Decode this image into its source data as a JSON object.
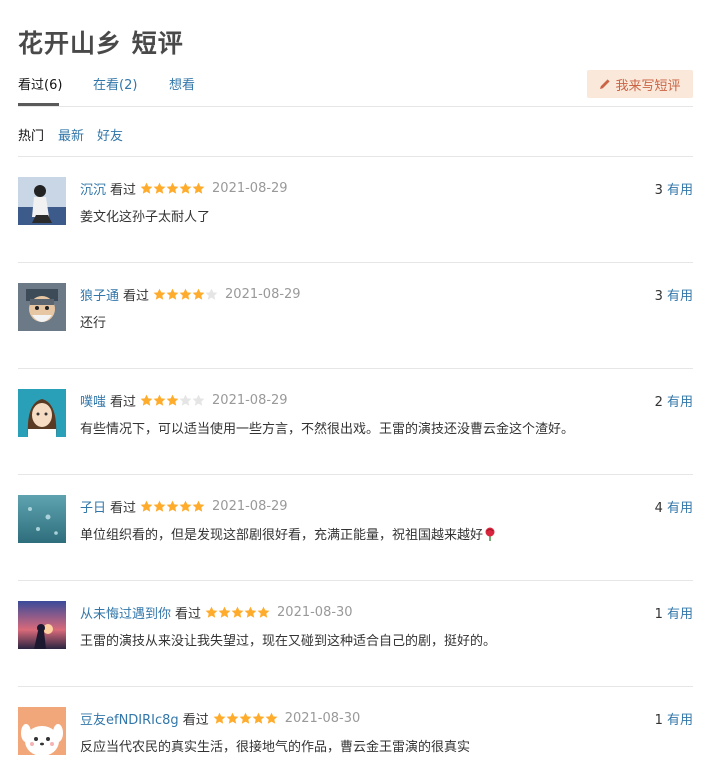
{
  "page_title": "花开山乡 短评",
  "tabs": [
    {
      "label": "看过(6)"
    },
    {
      "label": "在看(2)"
    },
    {
      "label": "想看"
    }
  ],
  "write_button": {
    "label": "我来写短评",
    "icon": "pencil-icon"
  },
  "filters": [
    {
      "label": "热门"
    },
    {
      "label": "最新"
    },
    {
      "label": "好友"
    }
  ],
  "colors": {
    "link": "#3377aa",
    "star": "#ffac2d",
    "star_empty": "#e5e5e5",
    "button_bg": "#fae9da",
    "button_text": "#ca6445"
  },
  "comments": [
    {
      "user": "沉沉",
      "status": "看过",
      "rating": 5,
      "date": "2021-08-29",
      "votes": "3",
      "votes_label": "有用",
      "content": "姜文化这孙子太耐人了"
    },
    {
      "user": "狼子通",
      "status": "看过",
      "rating": 4,
      "date": "2021-08-29",
      "votes": "3",
      "votes_label": "有用",
      "content": "还行"
    },
    {
      "user": "噗嗤",
      "status": "看过",
      "rating": 3,
      "date": "2021-08-29",
      "votes": "2",
      "votes_label": "有用",
      "content": "有些情况下，可以适当使用一些方言，不然很出戏。王雷的演技还没曹云金这个渣好。"
    },
    {
      "user": "子日",
      "status": "看过",
      "rating": 5,
      "date": "2021-08-29",
      "votes": "4",
      "votes_label": "有用",
      "content": "单位组织看的，但是发现这部剧很好看，充满正能量，祝祖国越来越好",
      "emoji": "rose-icon"
    },
    {
      "user": "从未悔过遇到你",
      "status": "看过",
      "rating": 5,
      "date": "2021-08-30",
      "votes": "1",
      "votes_label": "有用",
      "content": "王雷的演技从来没让我失望过，现在又碰到这种适合自己的剧，挺好的。"
    },
    {
      "user": "豆友efNDIRIc8g",
      "status": "看过",
      "rating": 5,
      "date": "2021-08-30",
      "votes": "1",
      "votes_label": "有用",
      "content": "反应当代农民的真实生活，很接地气的作品，曹云金王雷演的很真实"
    }
  ]
}
